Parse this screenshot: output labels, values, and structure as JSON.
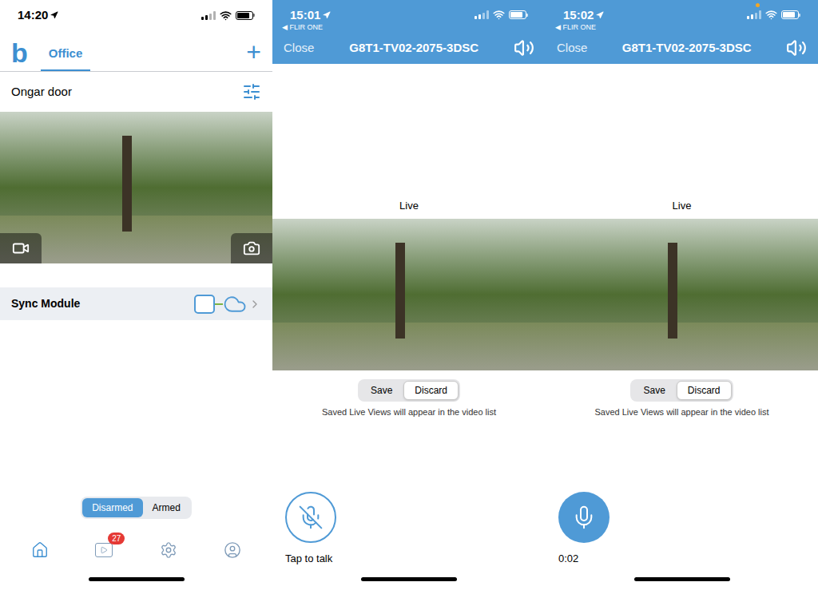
{
  "screens": [
    {
      "kind": "home",
      "status_bar": {
        "time": "14:20"
      },
      "logo": "b",
      "tabs": [
        {
          "label": "Office",
          "selected": true
        }
      ],
      "add_button": "+",
      "camera": {
        "name": "Ongar door"
      },
      "sync_module": {
        "label": "Sync Module"
      },
      "arm_toggle": [
        {
          "label": "Disarmed",
          "selected": true
        },
        {
          "label": "Armed",
          "selected": false
        }
      ],
      "nav": [
        {
          "selected": true,
          "badge": ""
        },
        {
          "selected": false,
          "badge": "27"
        },
        {
          "selected": false,
          "badge": ""
        },
        {
          "selected": false,
          "badge": ""
        }
      ]
    },
    {
      "kind": "live",
      "status_bar": {
        "time": "15:01",
        "back_app": "◀ FLIR ONE",
        "recording_dot": false
      },
      "close": "Close",
      "title": "G8T1-TV02-2075-3DSC",
      "view_label": "Live",
      "save_toggle": [
        {
          "label": "Save",
          "selected": false
        },
        {
          "label": "Discard",
          "selected": true
        }
      ],
      "hint": "Saved Live Views will appear in the video list",
      "talk": {
        "muted": true,
        "label": "Tap to talk"
      }
    },
    {
      "kind": "live",
      "status_bar": {
        "time": "15:02",
        "back_app": "◀ FLIR ONE",
        "recording_dot": true
      },
      "close": "Close",
      "title": "G8T1-TV02-2075-3DSC",
      "view_label": "Live",
      "save_toggle": [
        {
          "label": "Save",
          "selected": false
        },
        {
          "label": "Discard",
          "selected": true
        }
      ],
      "hint": "Saved Live Views will appear in the video list",
      "talk": {
        "muted": false,
        "label": "0:02"
      }
    }
  ]
}
